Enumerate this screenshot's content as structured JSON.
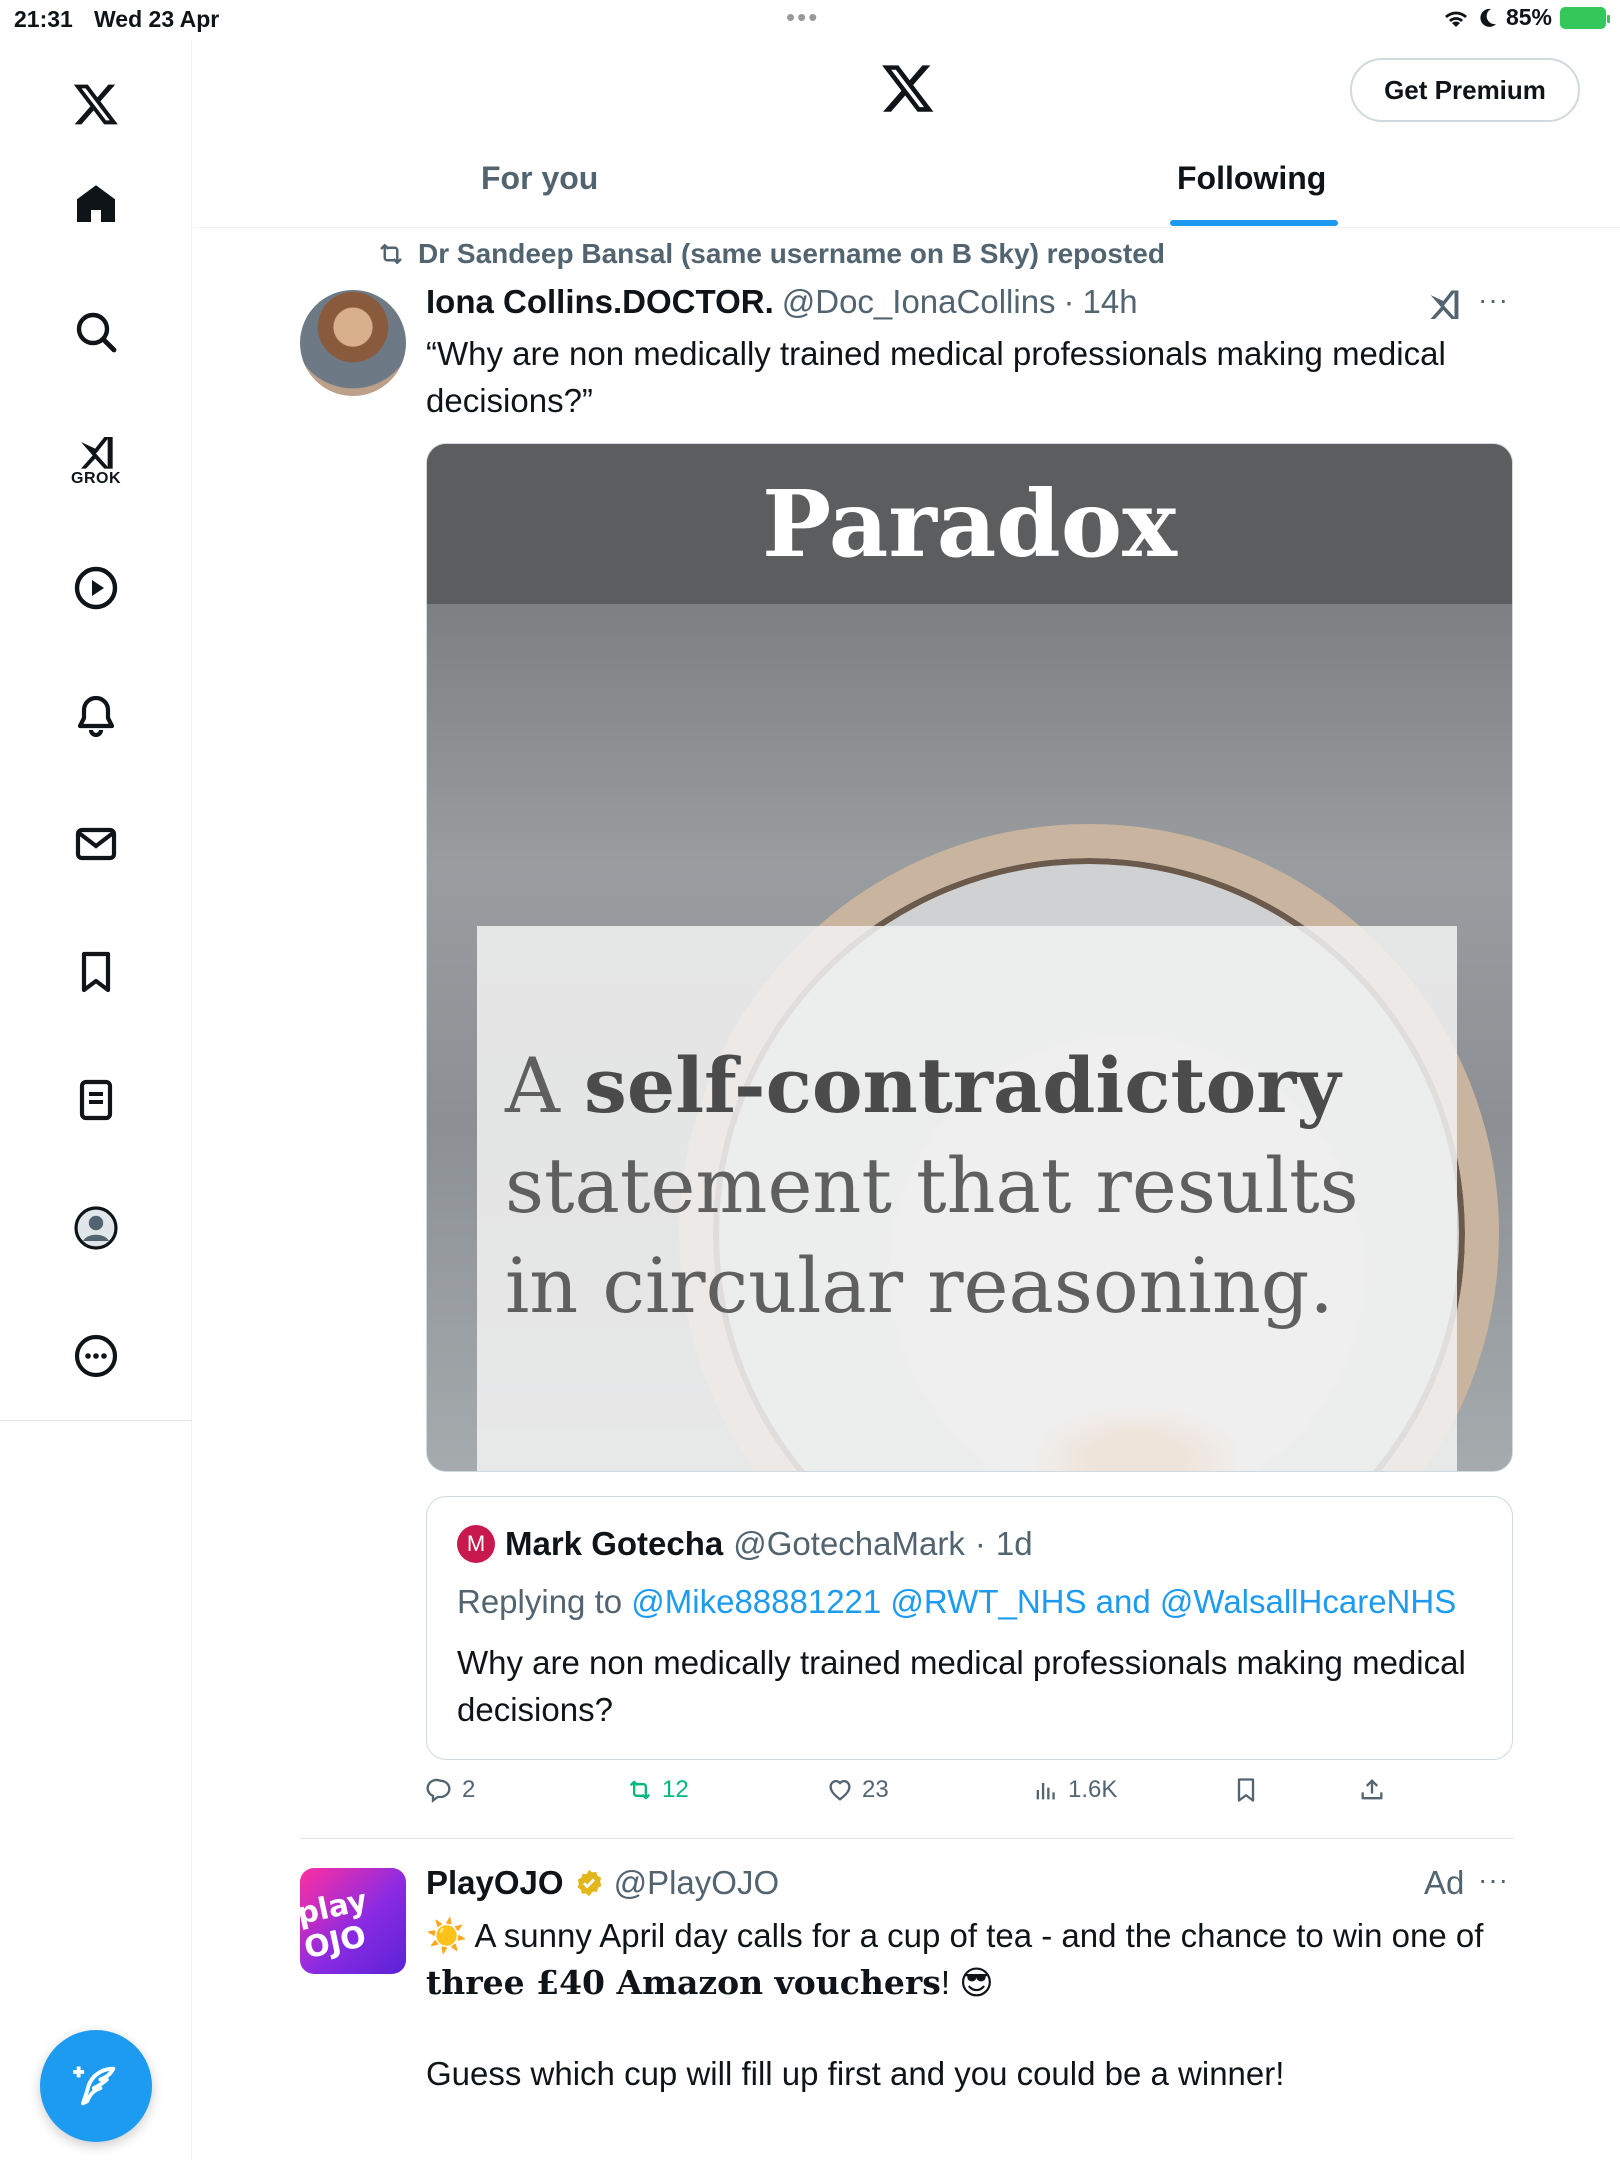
{
  "status": {
    "time": "21:31",
    "date": "Wed 23 Apr",
    "battery": "85%"
  },
  "sidebar": {
    "grok_label": "GROK"
  },
  "header": {
    "premium_label": "Get Premium",
    "tabs": [
      {
        "label": "For you",
        "active": false
      },
      {
        "label": "Following",
        "active": true
      }
    ]
  },
  "tweet1": {
    "repost_text": "Dr Sandeep Bansal (same username on B Sky) reposted",
    "author_name": "Iona Collins.DOCTOR.",
    "author_handle": "@Doc_IonaCollins",
    "time": "14h",
    "text": "“Why are non medically trained medical professionals making medical decisions?”",
    "media": {
      "title": "Paradox",
      "body_bold": "self-contradictory",
      "body_prefix": "A ",
      "body_rest": "statement that results in circular reasoning."
    },
    "quote": {
      "avatar_letter": "M",
      "author_name": "Mark Gotecha",
      "author_handle": "@GotechaMark",
      "time": "1d",
      "replying_prefix": "Replying to ",
      "mentions": "@Mike88881221 @RWT_NHS and @WalsallHcareNHS",
      "text": "Why are non medically trained medical professionals making medical decisions?"
    },
    "actions": {
      "replies": "2",
      "reposts": "12",
      "likes": "23",
      "views": "1.6K"
    }
  },
  "tweet2": {
    "author_name": "PlayOJO",
    "author_handle": "@PlayOJO",
    "avatar_text": "play OJO",
    "ad_label": "Ad",
    "text_part1": " A sunny April day calls for a cup of tea - and the chance to win one of ",
    "text_bold": "three £40 Amazon vouchers",
    "text_part2": "! ",
    "text_line2": "Guess which cup will fill up first and you could be a winner!"
  },
  "colors": {
    "accent": "#1d9bf0",
    "repost_green": "#00ba7c",
    "secondary_text": "#536471",
    "verified_gold": "#e2b719"
  }
}
